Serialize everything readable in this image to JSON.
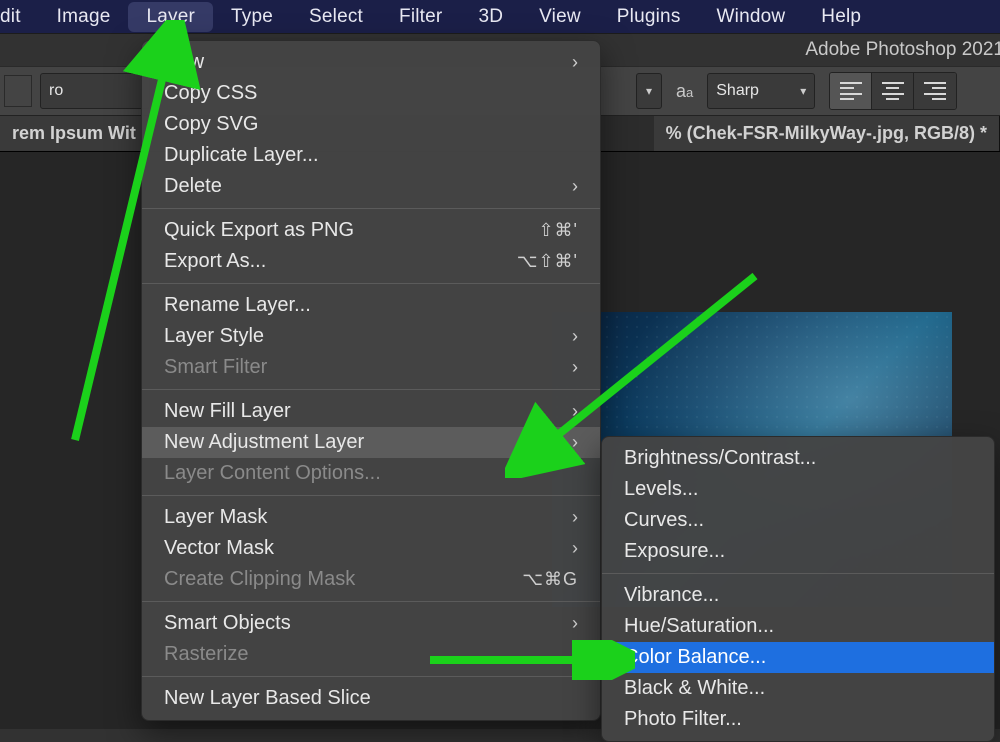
{
  "menubar": {
    "items": [
      "dit",
      "Image",
      "Layer",
      "Type",
      "Select",
      "Filter",
      "3D",
      "View",
      "Plugins",
      "Window",
      "Help"
    ],
    "active": "Layer"
  },
  "title": "Adobe Photoshop 2021",
  "options": {
    "font": "ro",
    "aa_label": "Sharp"
  },
  "tabs": {
    "left": "rem Ipsum Wit",
    "right": "% (Chek-FSR-MilkyWay-.jpg, RGB/8) *"
  },
  "layer_menu": [
    {
      "label": "New",
      "sub": true
    },
    {
      "label": "Copy CSS"
    },
    {
      "label": "Copy SVG"
    },
    {
      "label": "Duplicate Layer..."
    },
    {
      "label": "Delete",
      "sub": true
    },
    {
      "sep": true
    },
    {
      "label": "Quick Export as PNG",
      "shortcut": "⇧⌘'"
    },
    {
      "label": "Export As...",
      "shortcut": "⌥⇧⌘'"
    },
    {
      "sep": true
    },
    {
      "label": "Rename Layer..."
    },
    {
      "label": "Layer Style",
      "sub": true
    },
    {
      "label": "Smart Filter",
      "disabled": true,
      "sub": true
    },
    {
      "sep": true
    },
    {
      "label": "New Fill Layer",
      "sub": true
    },
    {
      "label": "New Adjustment Layer",
      "sub": true,
      "highlight": true
    },
    {
      "label": "Layer Content Options...",
      "disabled": true
    },
    {
      "sep": true
    },
    {
      "label": "Layer Mask",
      "sub": true
    },
    {
      "label": "Vector Mask",
      "sub": true
    },
    {
      "label": "Create Clipping Mask",
      "shortcut": "⌥⌘G",
      "disabled": true
    },
    {
      "sep": true
    },
    {
      "label": "Smart Objects",
      "sub": true
    },
    {
      "label": "Rasterize",
      "disabled": true,
      "sub": true
    },
    {
      "sep": true
    },
    {
      "label": "New Layer Based Slice"
    }
  ],
  "submenu": [
    {
      "label": "Brightness/Contrast..."
    },
    {
      "label": "Levels..."
    },
    {
      "label": "Curves..."
    },
    {
      "label": "Exposure..."
    },
    {
      "sep": true
    },
    {
      "label": "Vibrance..."
    },
    {
      "label": "Hue/Saturation..."
    },
    {
      "label": "Color Balance...",
      "sel": true
    },
    {
      "label": "Black & White..."
    },
    {
      "label": "Photo Filter..."
    }
  ]
}
